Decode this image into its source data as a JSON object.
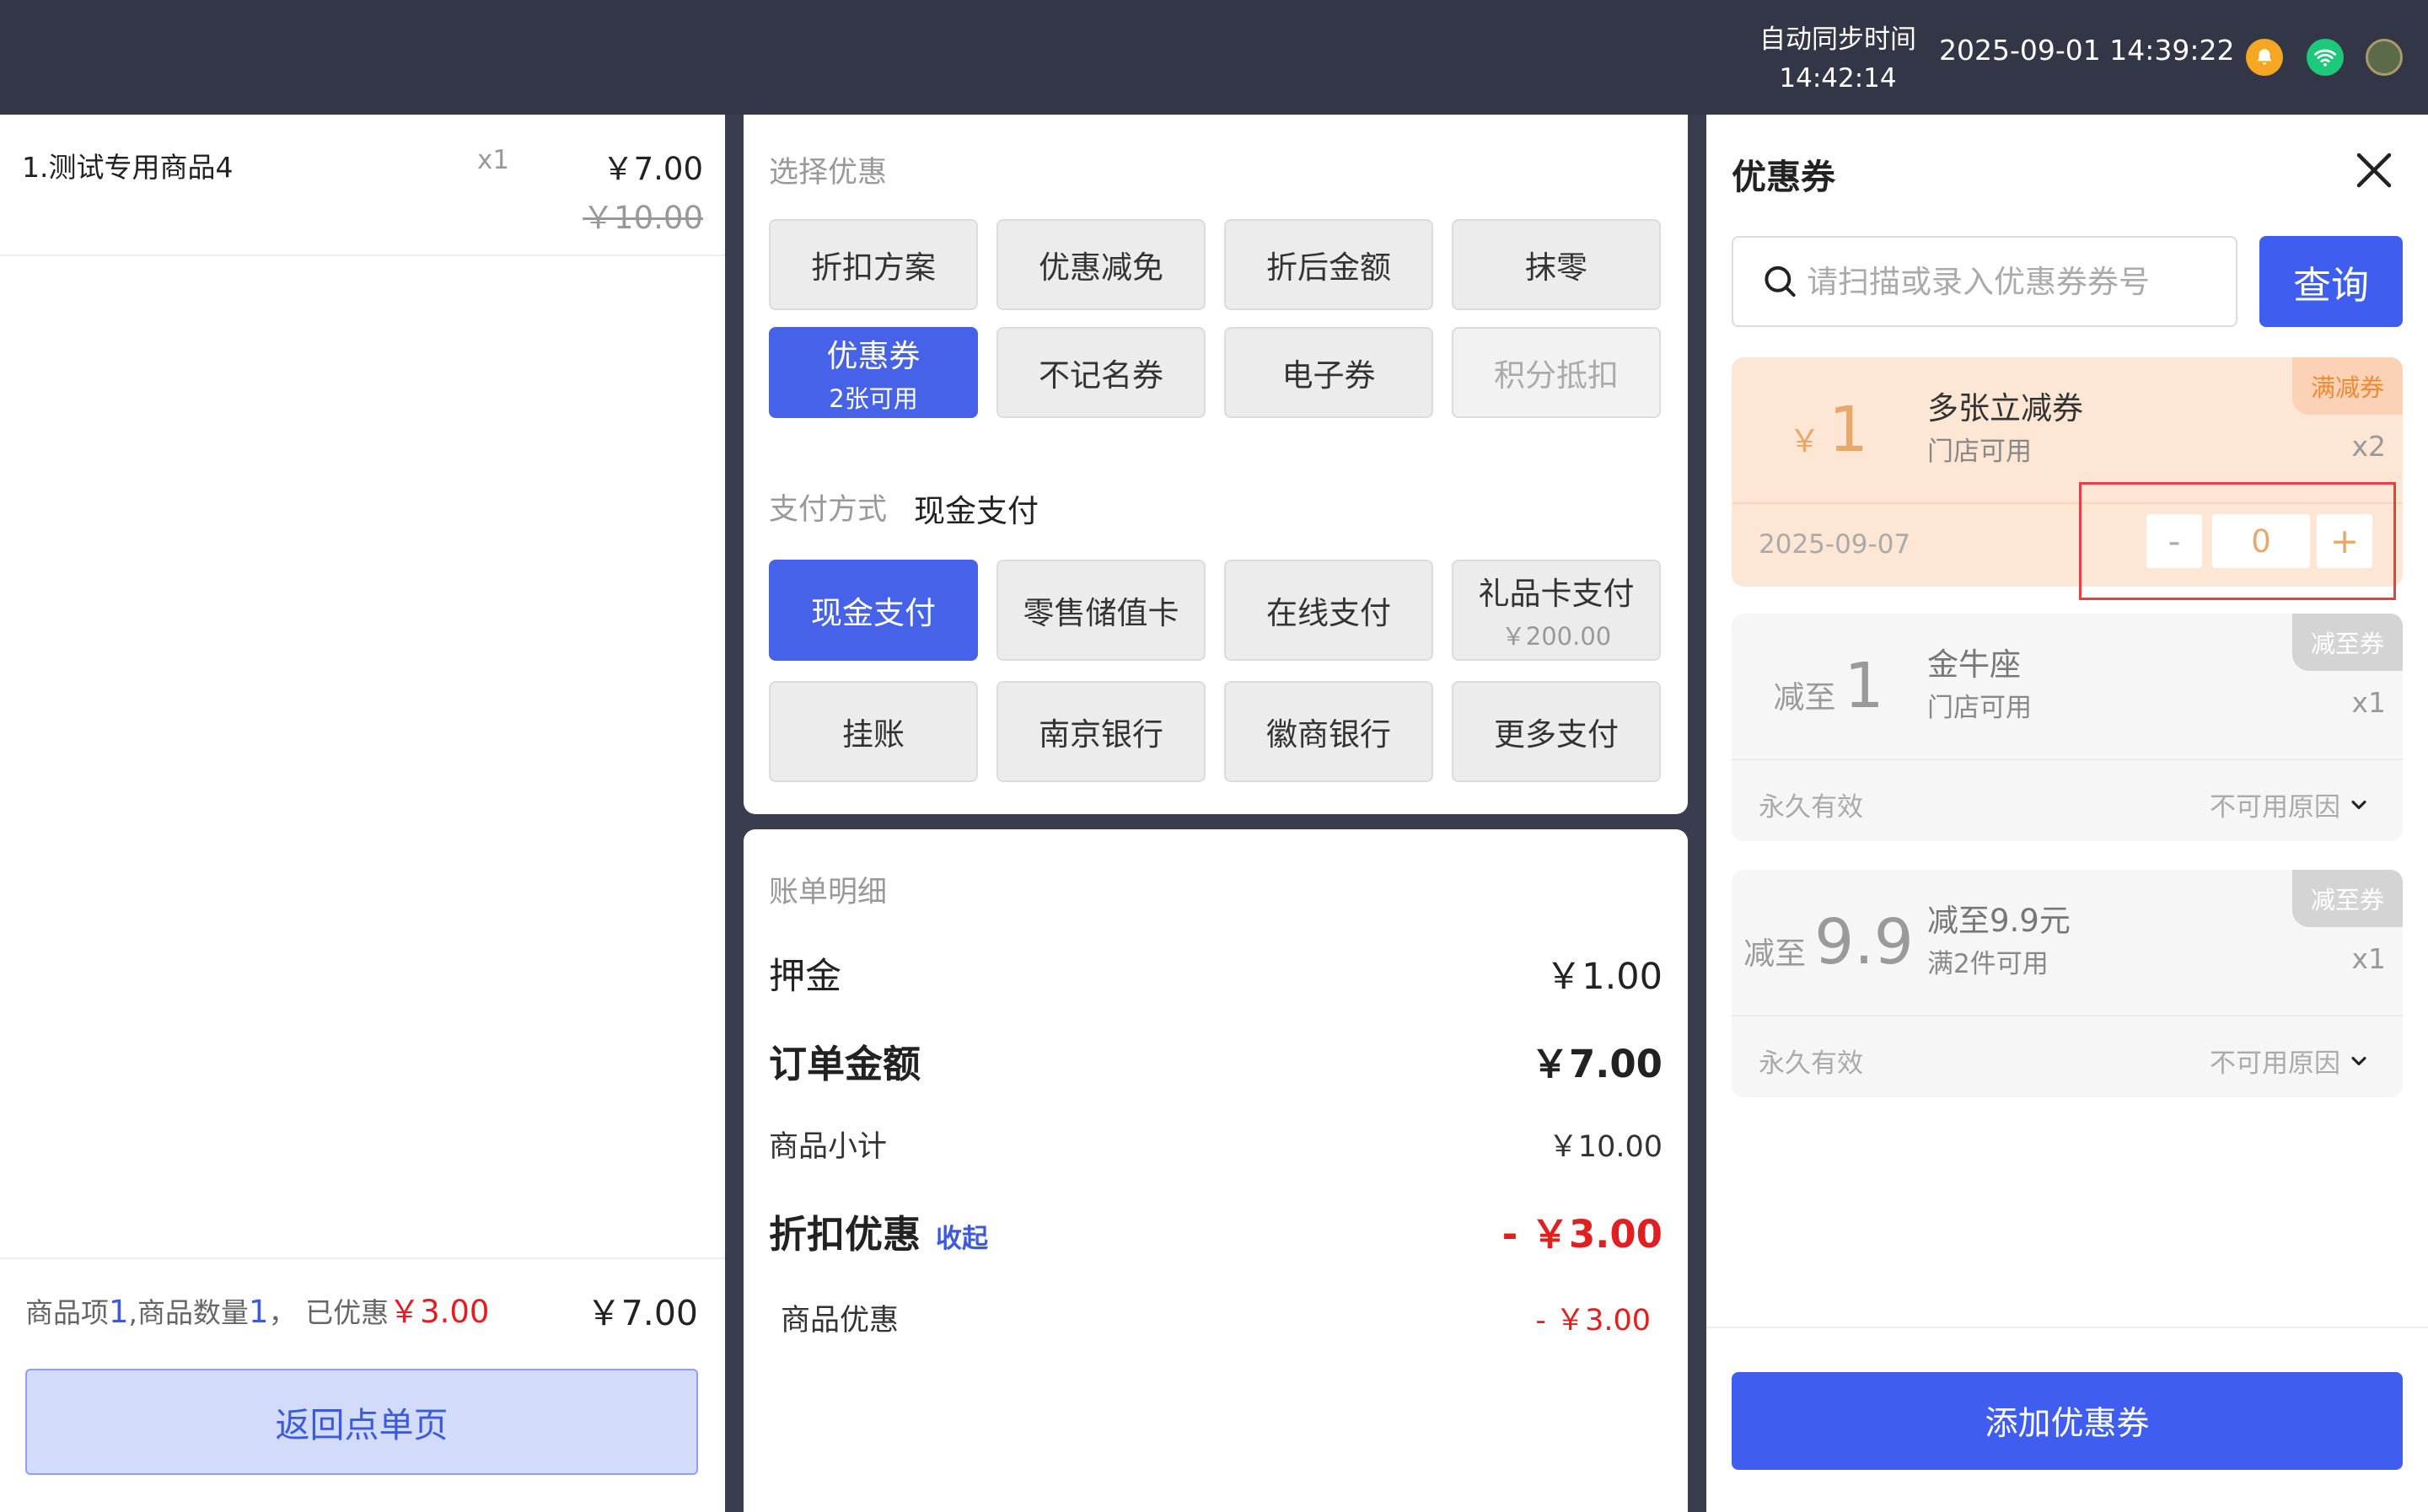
{
  "topbar": {
    "sync_label": "自动同步时间",
    "sync_time": "14:42:14",
    "datetime": "2025-09-01  14:39:22",
    "icons": [
      "bell-icon",
      "wifi-icon",
      "avatar"
    ]
  },
  "cart": {
    "item": {
      "name": "1.测试专用商品4",
      "qty": "x1",
      "price": "￥7.00",
      "original_price": "￥10.00"
    },
    "summary": {
      "items_label": "商品项",
      "items_count": "1",
      "qty_label": ",商品数量",
      "qty_count": "1",
      "discount_label": "， 已优惠",
      "discount_value": "￥3.00",
      "total": "￥7.00"
    },
    "back_button": "返回点单页"
  },
  "discount": {
    "section_label": "选择优惠",
    "options": [
      {
        "label": "折扣方案"
      },
      {
        "label": "优惠减免"
      },
      {
        "label": "折后金额"
      },
      {
        "label": "抹零"
      },
      {
        "label": "优惠券",
        "sub": "2张可用",
        "selected": true
      },
      {
        "label": "不记名券"
      },
      {
        "label": "电子券"
      },
      {
        "label": "积分抵扣",
        "disabled": true
      }
    ]
  },
  "payment": {
    "label": "支付方式",
    "current": "现金支付",
    "methods": [
      {
        "label": "现金支付",
        "selected": true
      },
      {
        "label": "零售储值卡"
      },
      {
        "label": "在线支付"
      },
      {
        "label": "礼品卡支付",
        "sub": "￥200.00"
      },
      {
        "label": "挂账"
      },
      {
        "label": "南京银行"
      },
      {
        "label": "徽商银行"
      },
      {
        "label": "更多支付"
      }
    ]
  },
  "bill": {
    "title": "账单明细",
    "deposit_label": "押金",
    "deposit_value": "￥1.00",
    "order_label": "订单金额",
    "order_value": "￥7.00",
    "subtotal_label": "商品小计",
    "subtotal_value": "￥10.00",
    "discount_label": "折扣优惠",
    "collapse_label": "收起",
    "discount_value": "- ￥3.00",
    "goods_discount_label": "商品优惠",
    "goods_discount_value": "- ￥3.00"
  },
  "coupons": {
    "title": "优惠券",
    "search_placeholder": "请扫描或录入优惠券券号",
    "search_value": "",
    "query_button": "查询",
    "list": [
      {
        "tag": "满减券",
        "prefix": "￥",
        "value": "1",
        "name": "多张立减券",
        "desc": "门店可用",
        "count": "x2",
        "expiry": "2025-09-07",
        "stepper": {
          "minus": "-",
          "value": "0",
          "plus": "+"
        }
      },
      {
        "tag": "减至券",
        "prefix": "减至",
        "value": "1",
        "name": "金牛座",
        "desc": "门店可用",
        "count": "x1",
        "expiry": "永久有效",
        "reason": "不可用原因"
      },
      {
        "tag": "减至券",
        "prefix": "减至",
        "value": "9.9",
        "name": "减至9.9元",
        "desc": "满2件可用",
        "count": "x1",
        "expiry": "永久有效",
        "reason": "不可用原因"
      }
    ],
    "add_button": "添加优惠券"
  },
  "colors": {
    "accent": "#3f5ef0",
    "selected_button": "#4662e8",
    "discount_red": "#e02020",
    "coupon_active_bg": "#fde6d3",
    "coupon_orange": "#e8a86a",
    "highlight_box": "#e84040"
  }
}
